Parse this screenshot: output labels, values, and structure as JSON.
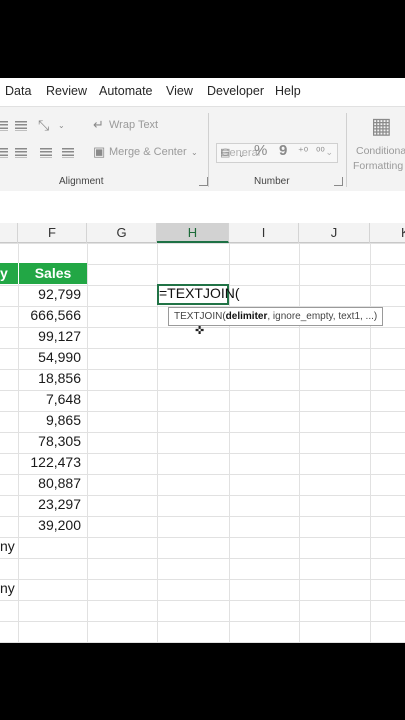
{
  "menu": [
    "Data",
    "Review",
    "Automate",
    "View",
    "Developer",
    "Help"
  ],
  "ribbon": {
    "wrap_text": "Wrap Text",
    "merge_center": "Merge & Center",
    "alignment_label": "Alignment",
    "number_format": "General",
    "number_label": "Number",
    "percent_symbol": "%",
    "comma_symbol": "9",
    "conditional_line1": "Conditional",
    "conditional_line2": "Formatting"
  },
  "columns": [
    "F",
    "G",
    "H",
    "I",
    "J",
    "K"
  ],
  "selected_column": "H",
  "sales_header": "Sales",
  "partial_header": "y",
  "sales": [
    "92,799",
    "666,566",
    "99,127",
    "54,990",
    "18,856",
    "7,648",
    "9,865",
    "78,305",
    "122,473",
    "80,887",
    "23,297",
    "39,200"
  ],
  "partial_cells": {
    "row9": "ny",
    "row11": "ny"
  },
  "formula_text": "=TEXTJOIN(",
  "tooltip": {
    "func": "TEXTJOIN(",
    "arg_bold": "delimiter",
    "rest": ", ignore_empty, text1, ...)"
  },
  "accent_green": "#22a745",
  "cursor_icon": "plus-cursor-icon"
}
